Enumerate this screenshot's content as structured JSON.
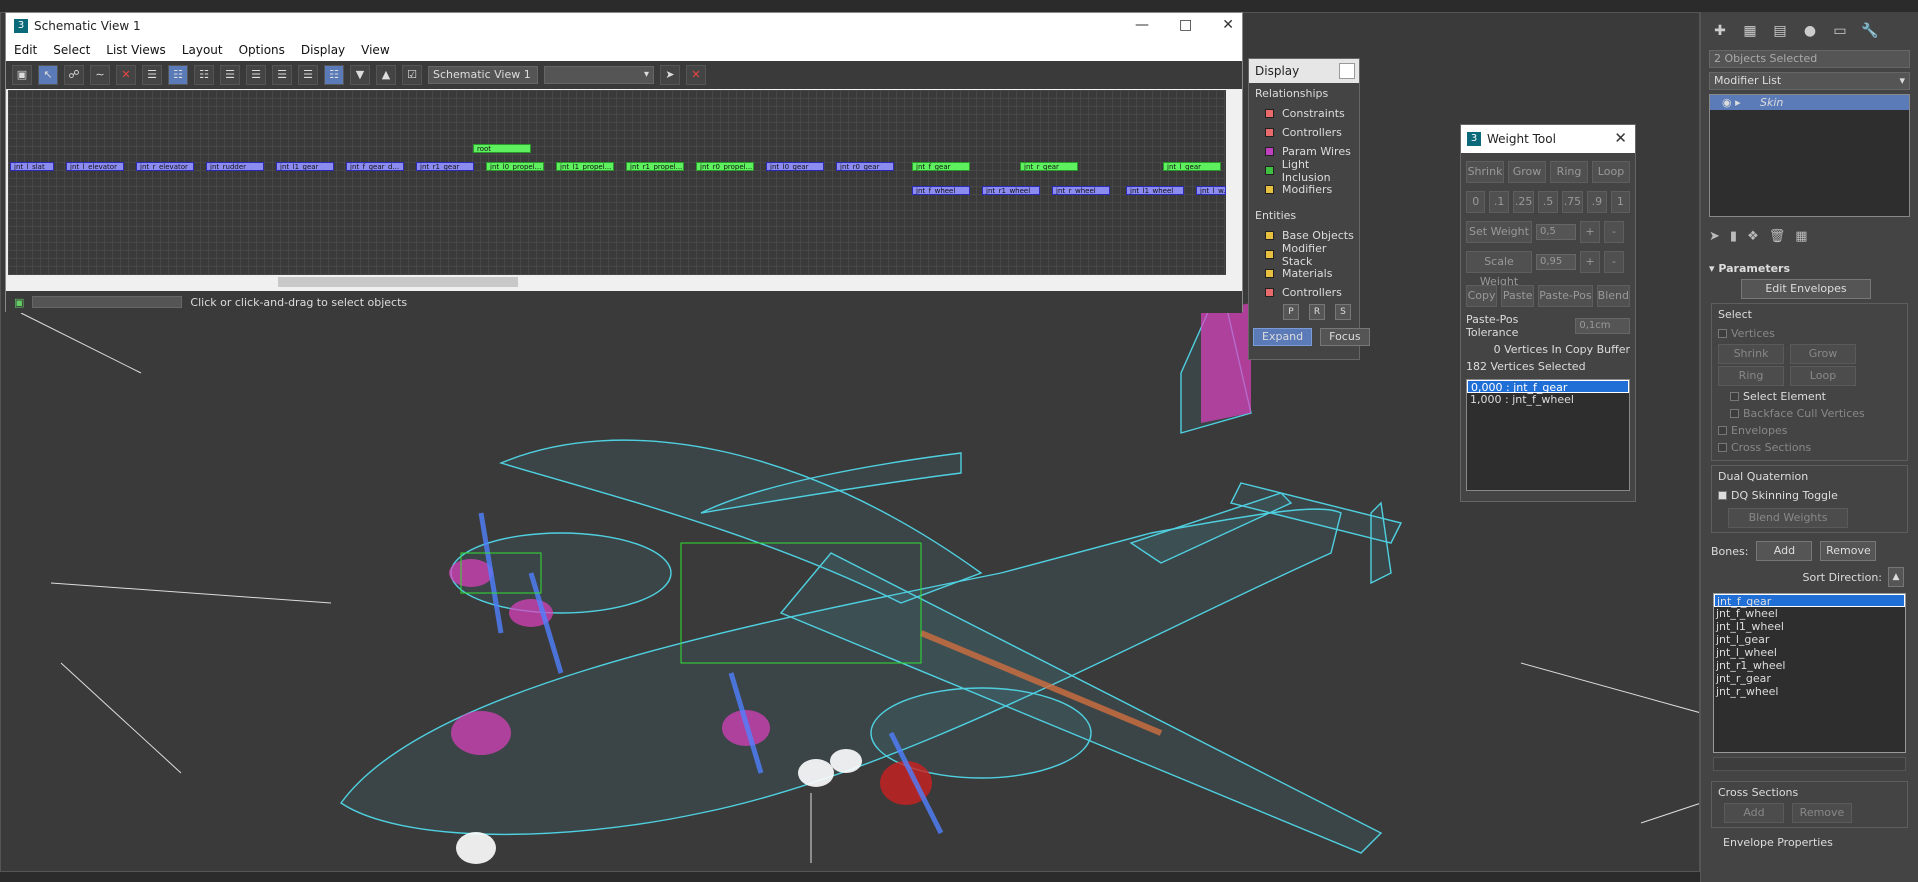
{
  "schematic": {
    "title": "Schematic View 1",
    "menu": [
      "Edit",
      "Select",
      "List Views",
      "Layout",
      "Options",
      "Display",
      "View"
    ],
    "view_name": "Schematic View 1",
    "status_text": "Click or click-and-drag to select objects",
    "nodes_row1": [
      "jnt_l_slat",
      "jnt_l_elevator",
      "jnt_r_elevator",
      "jnt_rudder",
      "jnt_l1_gear",
      "jnt_f_gear_d...",
      "jnt_r1_gear",
      "jnt_l0_propel...",
      "jnt_l1_propel...",
      "jnt_r1_propel...",
      "jnt_r0_propel...",
      "jnt_l0_gear",
      "jnt_r0_gear",
      "jnt_f_gear",
      "jnt_r_gear",
      "jnt_l_gear"
    ],
    "nodes_row2": [
      "jnt_f_wheel",
      "jnt_r1_wheel",
      "jnt_r_wheel",
      "jnt_l1_wheel",
      "jnt_l_w..."
    ],
    "root_node": "root"
  },
  "display_panel": {
    "title": "Display",
    "relationships_label": "Relationships",
    "relationships": [
      {
        "label": "Constraints",
        "color": "#e86a6a"
      },
      {
        "label": "Controllers",
        "color": "#e86a6a"
      },
      {
        "label": "Param Wires",
        "color": "#c040c0"
      },
      {
        "label": "Light Inclusion",
        "color": "#40c040"
      },
      {
        "label": "Modifiers",
        "color": "#e8c040"
      }
    ],
    "entities_label": "Entities",
    "entities": [
      {
        "label": "Base Objects",
        "color": "#e8c040"
      },
      {
        "label": "Modifier Stack",
        "color": "#e8c040"
      },
      {
        "label": "Materials",
        "color": "#e8c040"
      },
      {
        "label": "Controllers",
        "color": "#e86a6a"
      }
    ],
    "psr": [
      "P",
      "R",
      "S"
    ],
    "expand": "Expand",
    "focus": "Focus"
  },
  "weight_tool": {
    "title": "Weight Tool",
    "row1": [
      "Shrink",
      "Grow",
      "Ring",
      "Loop"
    ],
    "presets": [
      "0",
      ".1",
      ".25",
      ".5",
      ".75",
      ".9",
      "1"
    ],
    "set_weight": "Set Weight",
    "set_value": "0,5",
    "scale_weight": "Scale Weight",
    "scale_value": "0,95",
    "plus": "+",
    "minus": "-",
    "row4": [
      "Copy",
      "Paste",
      "Paste-Pos",
      "Blend"
    ],
    "tolerance_label": "Paste-Pos Tolerance",
    "tolerance_value": "0,1cm",
    "copy_buffer": "0 Vertices In Copy Buffer",
    "vertices_selected": "182 Vertices Selected",
    "weights": [
      "0,000 : jnt_f_gear",
      "1,000 : jnt_f_wheel"
    ]
  },
  "command_panel": {
    "objects_selected": "2 Objects Selected",
    "modifier_list": "Modifier List",
    "modifier": "Skin",
    "parameters": "Parameters",
    "edit_envelopes": "Edit Envelopes",
    "select_label": "Select",
    "vertices": "Vertices",
    "shrink": "Shrink",
    "grow": "Grow",
    "ring": "Ring",
    "loop": "Loop",
    "select_element": "Select Element",
    "backface": "Backface Cull Vertices",
    "envelopes": "Envelopes",
    "cross_sections": "Cross Sections",
    "dq_label": "Dual Quaternion",
    "dq_toggle": "DQ Skinning Toggle",
    "blend_weights": "Blend Weights",
    "bones_label": "Bones:",
    "add": "Add",
    "remove": "Remove",
    "sort_direction": "Sort Direction:",
    "bones": [
      "jnt_f_gear",
      "jnt_f_wheel",
      "jnt_l1_wheel",
      "jnt_l_gear",
      "jnt_l_wheel",
      "jnt_r1_wheel",
      "jnt_r_gear",
      "jnt_r_wheel"
    ],
    "cross_sections_label": "Cross Sections",
    "envelope_properties": "Envelope Properties"
  }
}
